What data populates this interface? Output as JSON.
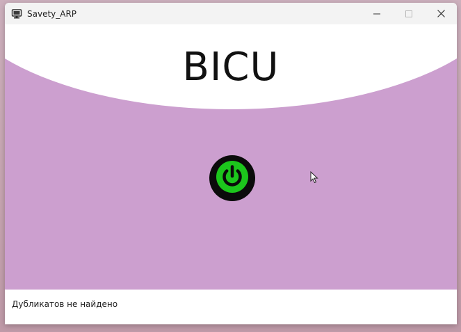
{
  "window": {
    "title": "Savety_ARP",
    "controls": [
      "minimize-icon",
      "maximize-icon",
      "close-icon"
    ]
  },
  "header": {
    "title": "BICU"
  },
  "main": {
    "power_button_icon": "power-icon",
    "power_icon_color": "#2fd12f",
    "background_color": "#cc9fcf"
  },
  "status": {
    "message": "Дубликатов не найдено"
  }
}
